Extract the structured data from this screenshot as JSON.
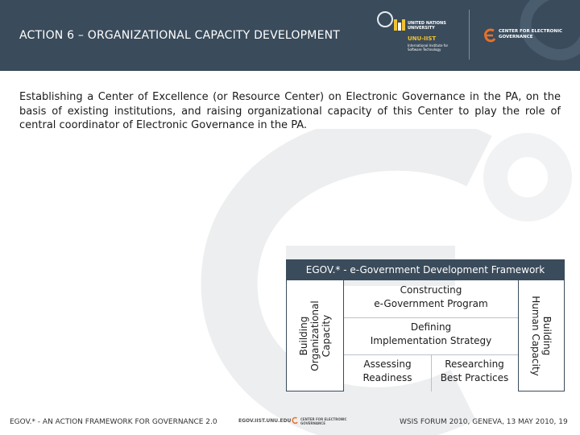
{
  "header": {
    "title": "ACTION 6 – ORGANIZATIONAL CAPACITY DEVELOPMENT",
    "unu_name": "UNITED NATIONS UNIVERSITY",
    "unu_short": "UNU-IIST",
    "unu_sub": "International Institute for Software Technology",
    "cegov_name": "CENTER FOR ELECTRONIC GOVERNANCE"
  },
  "intro": "Establishing a Center of Excellence (or Resource Center) on Electronic Governance in the PA, on the basis of existing institutions, and raising organizational capacity of this Center to play the role of central coordinator of Electronic Governance in the PA.",
  "framework": {
    "title": "EGOV.* - e-Government Development Framework",
    "left_label": "Building\nOrganizational\nCapacity",
    "right_label": "Building\nHuman Capacity",
    "cells": {
      "program": "Constructing\ne-Government Program",
      "strategy": "Defining\nImplementation Strategy",
      "readiness": "Assessing\nReadiness",
      "practices": "Researching\nBest Practices"
    }
  },
  "footer": {
    "left": "EGOV.* - AN ACTION FRAMEWORK FOR GOVERNANCE 2.0",
    "url": "EGOV.IIST.UNU.EDU",
    "cegov": "CENTER FOR ELECTRONIC GOVERNANCE",
    "right": "WSIS FORUM 2010, GENEVA, 13 MAY 2010, 19"
  },
  "colors": {
    "header_bg": "#3a4b5b",
    "accent_orange": "#e8702a",
    "accent_gold": "#f2c230"
  },
  "icons": [
    "un-emblem-icon",
    "unu-logo-icon",
    "cegov-logo-icon"
  ]
}
